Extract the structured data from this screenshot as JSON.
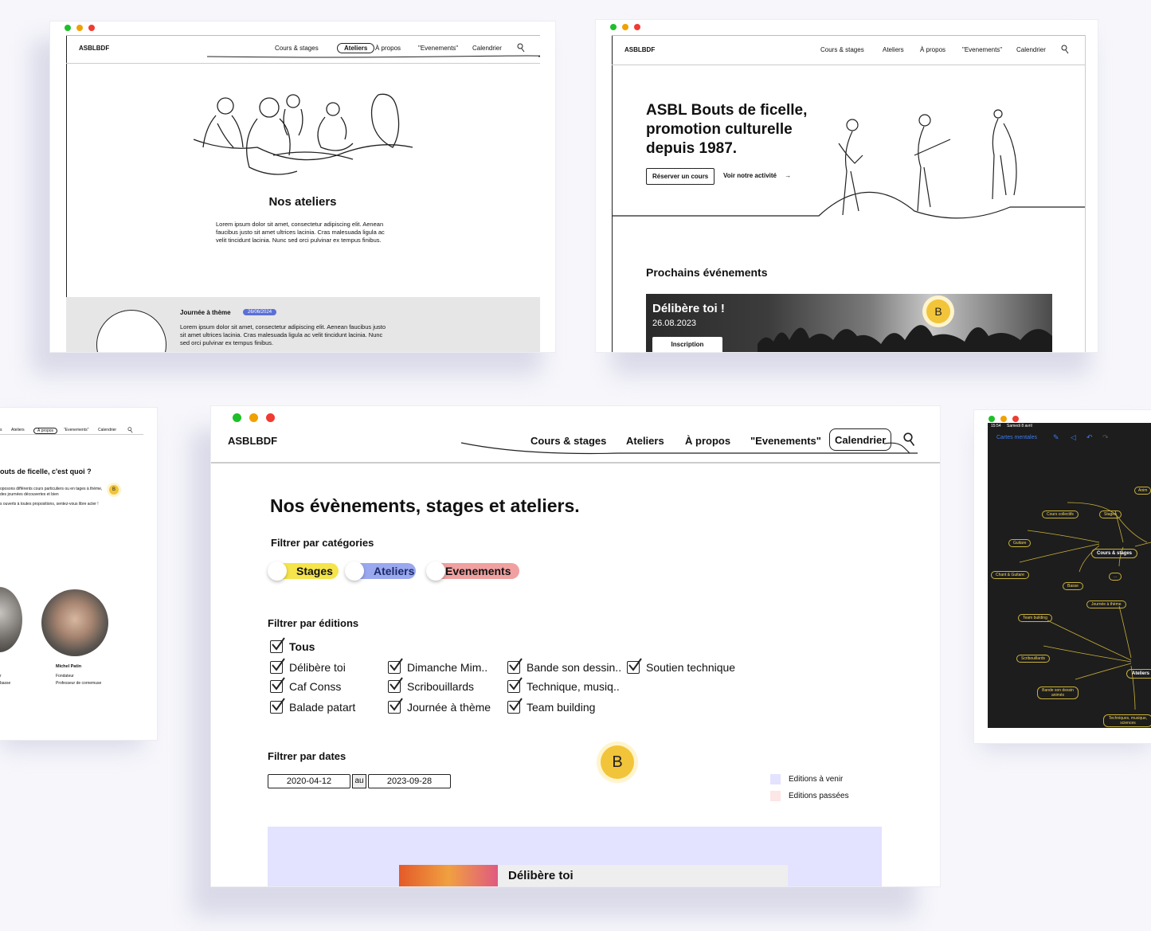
{
  "w1": {
    "brand": "ASBLBDF",
    "nav": [
      "Cours & stages",
      "Ateliers",
      "À propos",
      "\"Evenements\"",
      "Calendrier"
    ],
    "title": "Nos ateliers",
    "para": "Lorem ipsum dolor sit amet, consectetur adipiscing elit. Aenean faucibus justo sit amet ultrices lacinia. Cras malesuada ligula ac velit tincidunt lacinia. Nunc sed orci pulvinar ex tempus finibus.",
    "card_title": "Journée à thème",
    "card_date": "26/06/2024",
    "card_text": "Lorem ipsum dolor sit amet, consectetur adipiscing elit. Aenean faucibus justo sit amet ultrices lacinia. Cras malesuada ligula ac velit tincidunt lacinia. Nunc sed orci pulvinar ex tempus finibus."
  },
  "w2": {
    "brand": "ASBLBDF",
    "nav": [
      "Cours & stages",
      "Ateliers",
      "À propos",
      "\"Evenements\"",
      "Calendrier"
    ],
    "hero_title": "ASBL Bouts de ficelle, promotion culturelle depuis 1987.",
    "btn_book": "Réserver un cours",
    "btn_activity": "Voir notre activité",
    "events_title": "Prochains événements",
    "event_name": "Délibère toi !",
    "event_date": "26.08.2023",
    "event_btn": "Inscription",
    "badge": "B"
  },
  "w3": {
    "nav": [
      "s",
      "Ateliers",
      "À propos",
      "\"Evenements\"",
      "Calendrier"
    ],
    "title": "outs de ficelle, c'est quoi ?",
    "text1": "oposons différents cours particuliers ou en tages à thème, des journées découvertes et bien",
    "text2": "s ouverts à toutes propositions, sentez-vous libre acter !",
    "badge": "B",
    "person1_role": "r",
    "person1_sub": "basse",
    "person2_name": "Michel Patin",
    "person2_role": "Fondateur",
    "person2_sub": "Professeur de cornemuse"
  },
  "main": {
    "brand": "ASBLBDF",
    "nav": [
      "Cours & stages",
      "Ateliers",
      "À propos",
      "\"Evenements\"",
      "Calendrier"
    ],
    "title": "Nos évènements, stages et ateliers.",
    "filter_cat_label": "Filtrer par catégories",
    "chips": [
      {
        "label": "Stages",
        "color": "#f5e44a"
      },
      {
        "label": "Ateliers",
        "color": "#9aa8f0"
      },
      {
        "label": "Evenements",
        "color": "#f0a0a0"
      }
    ],
    "filter_ed_label": "Filtrer par éditions",
    "all_label": "Tous",
    "col1": [
      "Délibère toi",
      "Caf Conss",
      "Balade patart"
    ],
    "col2": [
      "Dimanche Mim..",
      "Scribouillards",
      "Journée à thème"
    ],
    "col3": [
      "Bande son dessin..",
      "Technique, musiq..",
      "Team building"
    ],
    "col4": [
      "Soutien technique"
    ],
    "filter_date_label": "Filtrer par dates",
    "date_from": "2020-04-12",
    "date_sep": "au",
    "date_to": "2023-09-28",
    "badge": "B",
    "legend_upcoming": "Editions à venir",
    "legend_past": "Editions passées",
    "legend_upcoming_color": "#e3e2ff",
    "legend_past_color": "#fde6e6",
    "event_title": "Délibère toi"
  },
  "w5": {
    "time": "15:54",
    "date": "Samedi 8 avril",
    "app_title": "Cartes mentales",
    "nodes": {
      "anim": "Anim",
      "cours_collectifs": "Cours collectifs",
      "stages": "Stages",
      "guitare": "Guitare",
      "cours_stages": "Cours & stages",
      "chant_guitare": "Chant & Guitare",
      "ellipsis": "...",
      "basse": "Basse",
      "journee": "Journée à thème",
      "team": "Team building",
      "scribouillards": "Scribouillards",
      "ateliers": "Ateliers",
      "bande_son": "Bande son dessin animés",
      "techniques": "Techniques, musique, sciences"
    }
  }
}
